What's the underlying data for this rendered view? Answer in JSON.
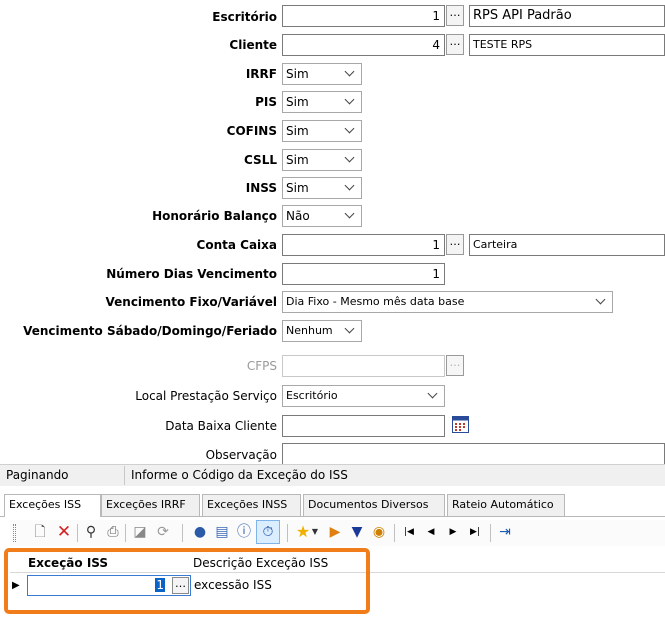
{
  "form": {
    "escritorio": {
      "label": "Escritório",
      "code": "1",
      "desc": "RPS API Padrão"
    },
    "cliente": {
      "label": "Cliente",
      "code": "4",
      "desc": "TESTE RPS"
    },
    "irrf": {
      "label": "IRRF",
      "value": "Sim"
    },
    "pis": {
      "label": "PIS",
      "value": "Sim"
    },
    "cofins": {
      "label": "COFINS",
      "value": "Sim"
    },
    "csll": {
      "label": "CSLL",
      "value": "Sim"
    },
    "inss": {
      "label": "INSS",
      "value": "Sim"
    },
    "honorario_balanco": {
      "label": "Honorário Balanço",
      "value": "Não"
    },
    "conta_caixa": {
      "label": "Conta Caixa",
      "code": "1",
      "desc": "Carteira"
    },
    "numero_dias_vencimento": {
      "label": "Número Dias Vencimento",
      "value": "1"
    },
    "vencimento_fixo_variavel": {
      "label": "Vencimento Fixo/Variável",
      "value": "Dia Fixo - Mesmo mês data base"
    },
    "vencimento_sabado": {
      "label": "Vencimento Sábado/Domingo/Feriado",
      "value": "Nenhum"
    },
    "cfps": {
      "label": "CFPS",
      "value": ""
    },
    "local_prestacao": {
      "label": "Local Prestação Serviço",
      "value": "Escritório"
    },
    "data_baixa_cliente": {
      "label": "Data Baixa Cliente",
      "value": ""
    },
    "observacao": {
      "label": "Observação",
      "value": ""
    }
  },
  "status": {
    "left": "Paginando",
    "right": "Informe o Código da Exceção do ISS"
  },
  "tabs": [
    "Exceções ISS",
    "Exceções IRRF",
    "Exceções INSS",
    "Documentos Diversos",
    "Rateio Automático"
  ],
  "toolbar": {
    "icons": [
      "new-icon",
      "delete-icon",
      "find-icon",
      "print-icon",
      "edit-icon",
      "refresh-icon",
      "web-icon",
      "report-icon",
      "info-icon",
      "timer-icon",
      "favorite-icon",
      "door-icon",
      "filter-icon",
      "help-icon",
      "first-icon",
      "prev-icon",
      "next-icon",
      "last-icon",
      "exit-icon"
    ]
  },
  "grid": {
    "columns": [
      "Exceção ISS",
      "Descrição Exceção ISS"
    ],
    "rows": [
      {
        "code": "1",
        "desc": "excessão ISS"
      }
    ]
  },
  "colors": {
    "highlight": "#f07d1a",
    "status_bar": "#f0f0f0",
    "accent_blue": "#0a64c8"
  }
}
